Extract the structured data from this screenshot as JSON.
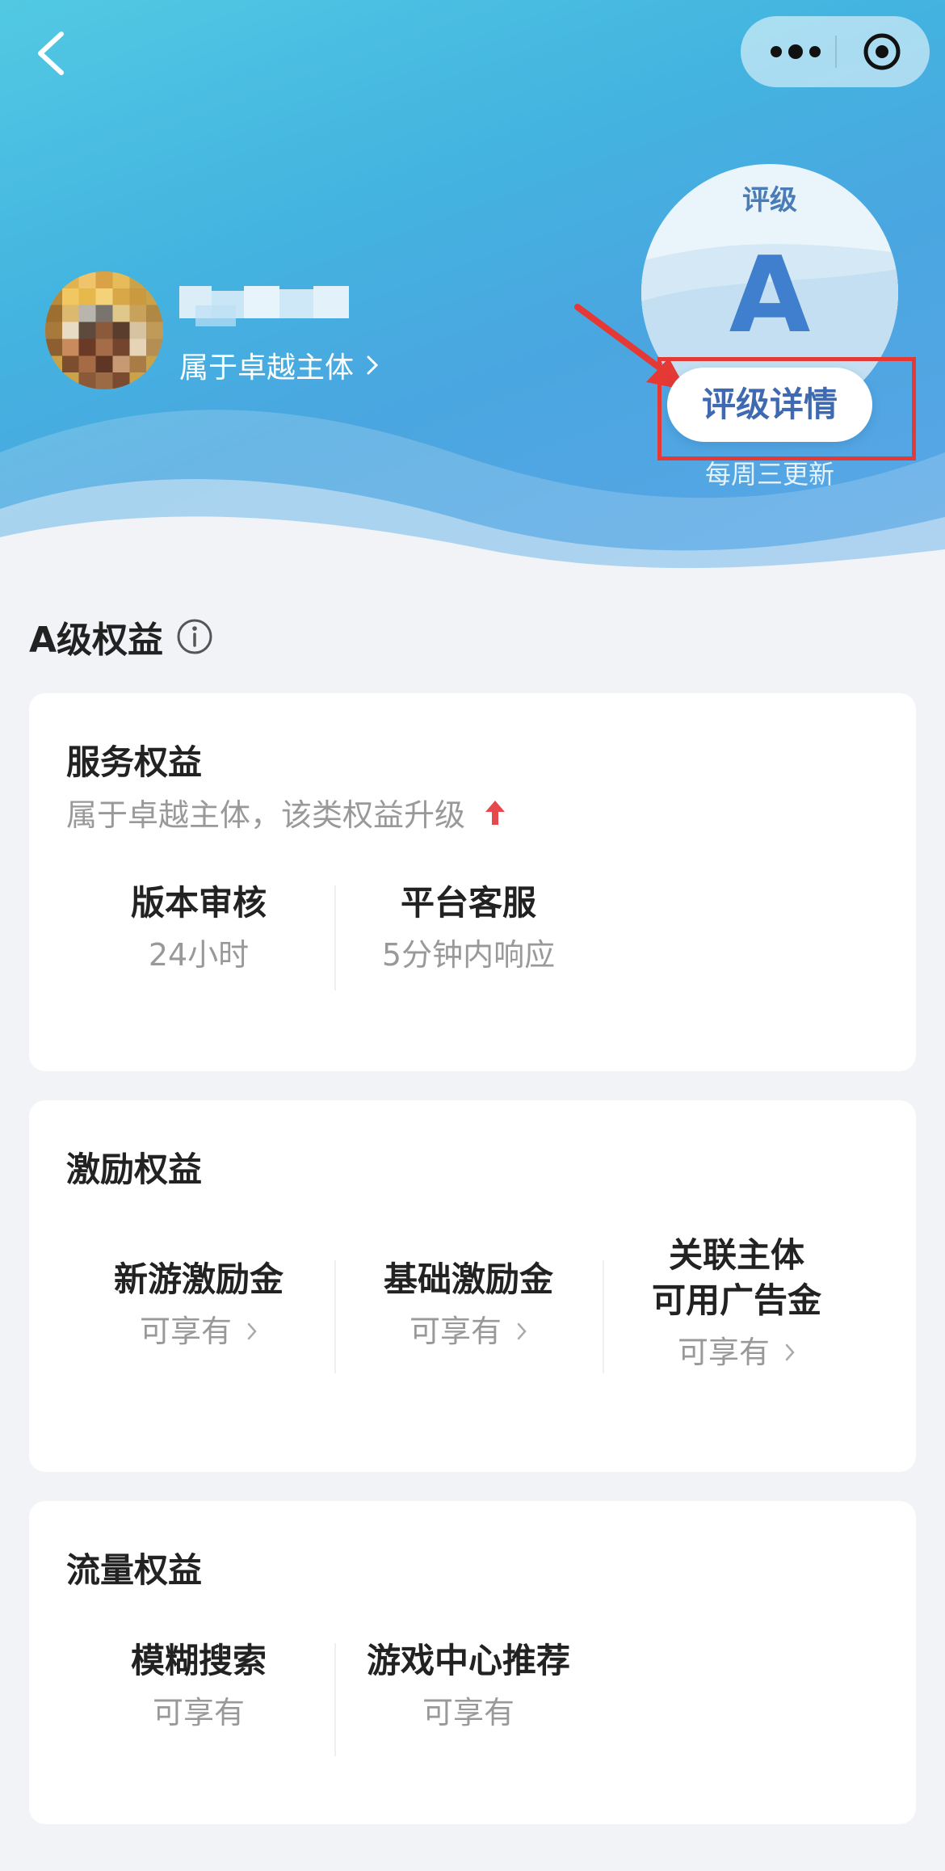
{
  "header": {
    "org_link": "属于卓越主体",
    "rating": {
      "label": "评级",
      "grade": "A",
      "detail_button": "评级详情",
      "update_note": "每周三更新"
    }
  },
  "section": {
    "title": "A级权益"
  },
  "cards": {
    "service": {
      "title": "服务权益",
      "subtitle": "属于卓越主体，该类权益升级",
      "items": [
        {
          "label": "版本审核",
          "value": "24小时"
        },
        {
          "label": "平台客服",
          "value": "5分钟内响应"
        }
      ]
    },
    "incentive": {
      "title": "激励权益",
      "items": [
        {
          "label": "新游激励金",
          "value": "可享有"
        },
        {
          "label": "基础激励金",
          "value": "可享有"
        },
        {
          "label_line1": "关联主体",
          "label_line2": "可用广告金",
          "value": "可享有"
        }
      ]
    },
    "traffic": {
      "title": "流量权益",
      "items": [
        {
          "label": "模糊搜索",
          "value": "可享有"
        },
        {
          "label": "游戏中心推荐",
          "value": "可享有"
        }
      ]
    }
  },
  "colors": {
    "accent": "#3f7fcd",
    "highlight_red": "#e53935",
    "upgrade_arrow": "#e5484d"
  }
}
